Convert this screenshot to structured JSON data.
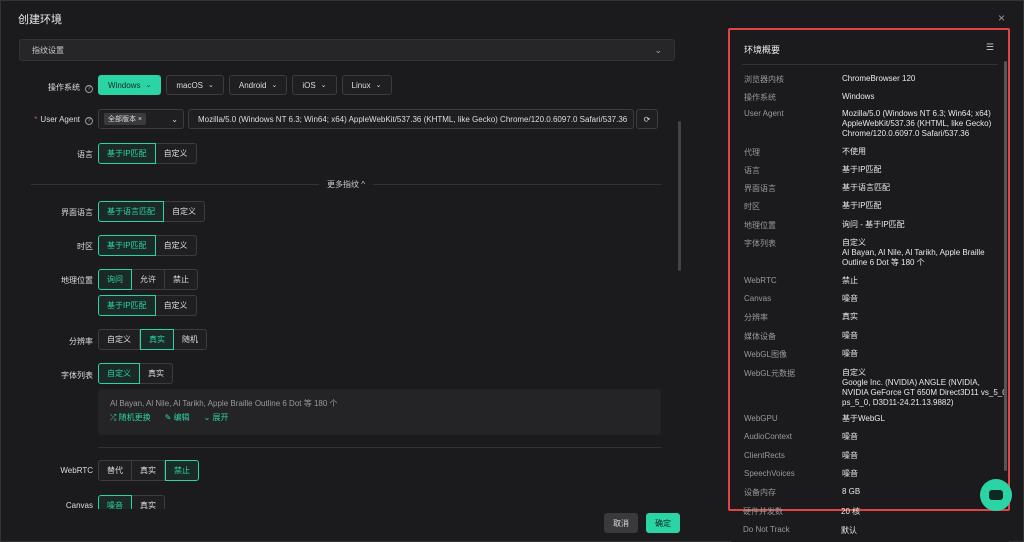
{
  "dialog": {
    "title": "创建环境",
    "close": "×"
  },
  "section": {
    "label": "指纹设置"
  },
  "os": {
    "label": "操作系统",
    "help": "?",
    "options": [
      "Windows",
      "macOS",
      "Android",
      "iOS",
      "Linux"
    ],
    "selected": "Windows"
  },
  "ua": {
    "label": "User Agent",
    "required": "*",
    "help": "?",
    "tag": "全部版本",
    "tag_close": "×",
    "value": "Mozilla/5.0 (Windows NT 6.3; Win64; x64) AppleWebKit/537.36 (KHTML, like Gecko) Chrome/120.0.6097.0 Safari/537.36"
  },
  "language": {
    "label": "语言",
    "options": [
      "基于IP匹配",
      "自定义"
    ],
    "selected": "基于IP匹配"
  },
  "more": {
    "label": "更多指纹 ^"
  },
  "ui_language": {
    "label": "界面语言",
    "options": [
      "基于语言匹配",
      "自定义"
    ],
    "selected": "基于语言匹配"
  },
  "timezone": {
    "label": "时区",
    "options": [
      "基于IP匹配",
      "自定义"
    ],
    "selected": "基于IP匹配"
  },
  "geo": {
    "label": "地理位置",
    "options": [
      "询问",
      "允许",
      "禁止"
    ],
    "selected": "询问",
    "sub_options": [
      "基于IP匹配",
      "自定义"
    ],
    "sub_selected": "基于IP匹配"
  },
  "resolution": {
    "label": "分辨率",
    "options": [
      "自定义",
      "真实",
      "随机"
    ],
    "selected": "真实"
  },
  "fonts": {
    "label": "字体列表",
    "options": [
      "自定义",
      "真实"
    ],
    "selected": "自定义",
    "list_text": "Al Bayan, Al Nile, Al Tarikh, Apple Braille Outline 6 Dot 等 180 个",
    "actions": [
      "随机更换",
      "编辑",
      "展开"
    ]
  },
  "webrtc": {
    "label": "WebRTC",
    "options": [
      "替代",
      "真实",
      "禁止"
    ],
    "selected": "禁止"
  },
  "canvas": {
    "label": "Canvas",
    "options": [
      "噪音",
      "真实"
    ],
    "selected": "噪音"
  },
  "footer": {
    "cancel": "取消",
    "ok": "确定"
  },
  "summary": {
    "title": "环境概要",
    "rows": [
      {
        "k": "浏览器内核",
        "v": "ChromeBrowser 120"
      },
      {
        "k": "操作系统",
        "v": "Windows"
      },
      {
        "k": "User Agent",
        "v": "Mozilla/5.0 (Windows NT 6.3; Win64; x64) AppleWebKit/537.36 (KHTML, like Gecko) Chrome/120.0.6097.0 Safari/537.36"
      },
      {
        "k": "代理",
        "v": "不使用"
      },
      {
        "k": "语言",
        "v": "基于IP匹配"
      },
      {
        "k": "界面语言",
        "v": "基于语言匹配"
      },
      {
        "k": "时区",
        "v": "基于IP匹配"
      },
      {
        "k": "地理位置",
        "v": "询问 - 基于IP匹配"
      },
      {
        "k": "字体列表",
        "v": "自定义\nAl Bayan, Al Nile, Al Tarikh, Apple Braille Outline 6 Dot 等 180 个"
      },
      {
        "k": "WebRTC",
        "v": "禁止"
      },
      {
        "k": "Canvas",
        "v": "噪音"
      },
      {
        "k": "分辨率",
        "v": "真实"
      },
      {
        "k": "媒体设备",
        "v": "噪音"
      },
      {
        "k": "WebGL图像",
        "v": "噪音"
      },
      {
        "k": "WebGL元数据",
        "v": "自定义\nGoogle Inc. (NVIDIA) ANGLE (NVIDIA, NVIDIA GeForce GT 650M Direct3D11 vs_5_0 ps_5_0, D3D11-24.21.13.9882)"
      },
      {
        "k": "WebGPU",
        "v": "基于WebGL"
      },
      {
        "k": "AudioContext",
        "v": "噪音"
      },
      {
        "k": "ClientRects",
        "v": "噪音"
      },
      {
        "k": "SpeechVoices",
        "v": "噪音"
      },
      {
        "k": "设备内存",
        "v": "8 GB"
      }
    ],
    "outside_rows": [
      {
        "k": "硬件并发数",
        "v": "20 核"
      },
      {
        "k": "Do Not Track",
        "v": "默认"
      }
    ]
  }
}
